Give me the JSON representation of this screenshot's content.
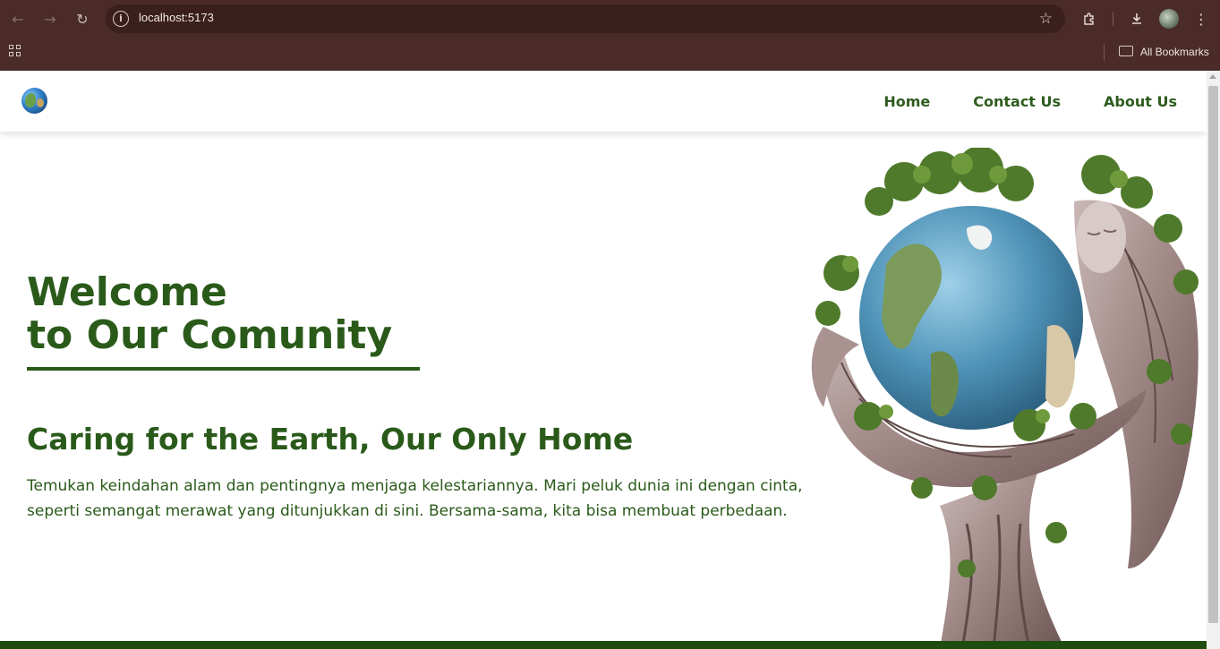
{
  "browser": {
    "url": "localhost:5173",
    "bookmarks_label": "All Bookmarks",
    "icons": {
      "back": "arrow-left-icon",
      "forward": "arrow-right-icon",
      "reload": "reload-icon",
      "site_info": "info-icon",
      "bookmark": "star-icon",
      "extensions": "puzzle-icon",
      "downloads": "download-icon",
      "menu": "kebab-menu-icon",
      "apps": "apps-grid-icon",
      "folder": "folder-icon"
    }
  },
  "site": {
    "logo": "globe-logo-icon",
    "nav": [
      {
        "label": "Home"
      },
      {
        "label": "Contact Us"
      },
      {
        "label": "About Us"
      }
    ]
  },
  "hero": {
    "title_line1": "Welcome",
    "title_line2": "to Our Comunity",
    "subtitle": "Caring for the Earth, Our Only Home",
    "description": "Temukan keindahan alam dan pentingnya menjaga kelestariannya. Mari peluk dunia ini dengan cinta, seperti semangat merawat yang ditunjukkan di sini. Bersama-sama, kita bisa membuat perbedaan.",
    "image": "tree-figure-hugging-earth-illustration"
  },
  "colors": {
    "brand_green": "#2a5a1a",
    "chrome_bg": "#4a2b27",
    "omnibox_bg": "#3a1f1c",
    "footer_green": "#1f4d10"
  }
}
